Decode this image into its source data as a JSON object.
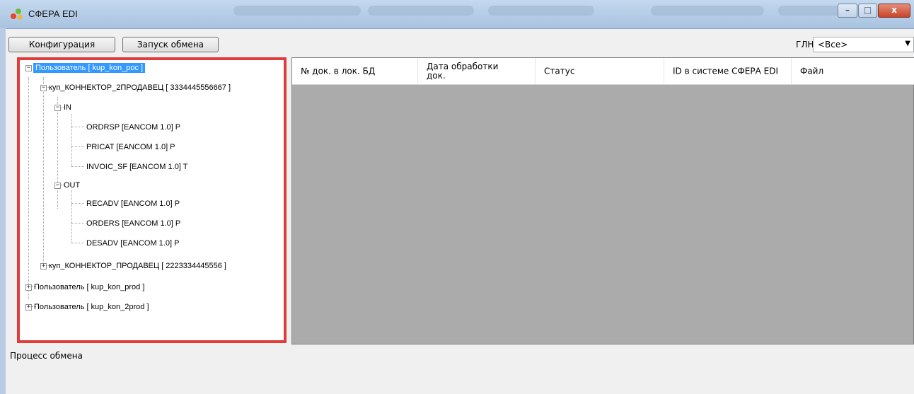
{
  "window": {
    "title": "СФЕРА EDI",
    "controls": {
      "minimize": "–",
      "maximize": "□",
      "close": "x"
    }
  },
  "toolbar": {
    "config_label": "Конфигурация",
    "start_label": "Запуск обмена",
    "gln_label": "ГЛН",
    "gln_value": "<Все>"
  },
  "tree": {
    "nodes": [
      {
        "label": "Пользователь [  kup_kon_poc ]",
        "expander": "−",
        "selected": true
      },
      {
        "label": "куп_КОННЕКТОР_2ПРОДАВЕЦ [ 3334445556667 ]",
        "expander": "−"
      },
      {
        "label": "IN",
        "expander": "−"
      },
      {
        "label": "ORDRSP [EANCOM 1.0] P"
      },
      {
        "label": "PRICAT [EANCOM 1.0] P"
      },
      {
        "label": "INVOIC_SF [EANCOM 1.0] T"
      },
      {
        "label": "OUT",
        "expander": "−"
      },
      {
        "label": "RECADV [EANCOM 1.0] P"
      },
      {
        "label": "ORDERS [EANCOM 1.0] P"
      },
      {
        "label": "DESADV [EANCOM 1.0] P"
      },
      {
        "label": "куп_КОННЕКТОР_ПРОДАВЕЦ [ 2223334445556 ]",
        "expander": "+"
      },
      {
        "label": "Пользователь [  kup_kon_prod ]",
        "expander": "+"
      },
      {
        "label": "Пользователь [  kup_kon_2prod ]",
        "expander": "+"
      }
    ]
  },
  "grid": {
    "columns": [
      "№ док. в лок. БД",
      "Дата обработки док.",
      "Статус",
      "ID в системе СФЕРА EDI",
      "Файл"
    ]
  },
  "status": {
    "label": "Процесс обмена"
  },
  "colors": {
    "selection": "#3399ff",
    "highlight_border": "#e03c3c",
    "grid_background": "#ababab"
  }
}
